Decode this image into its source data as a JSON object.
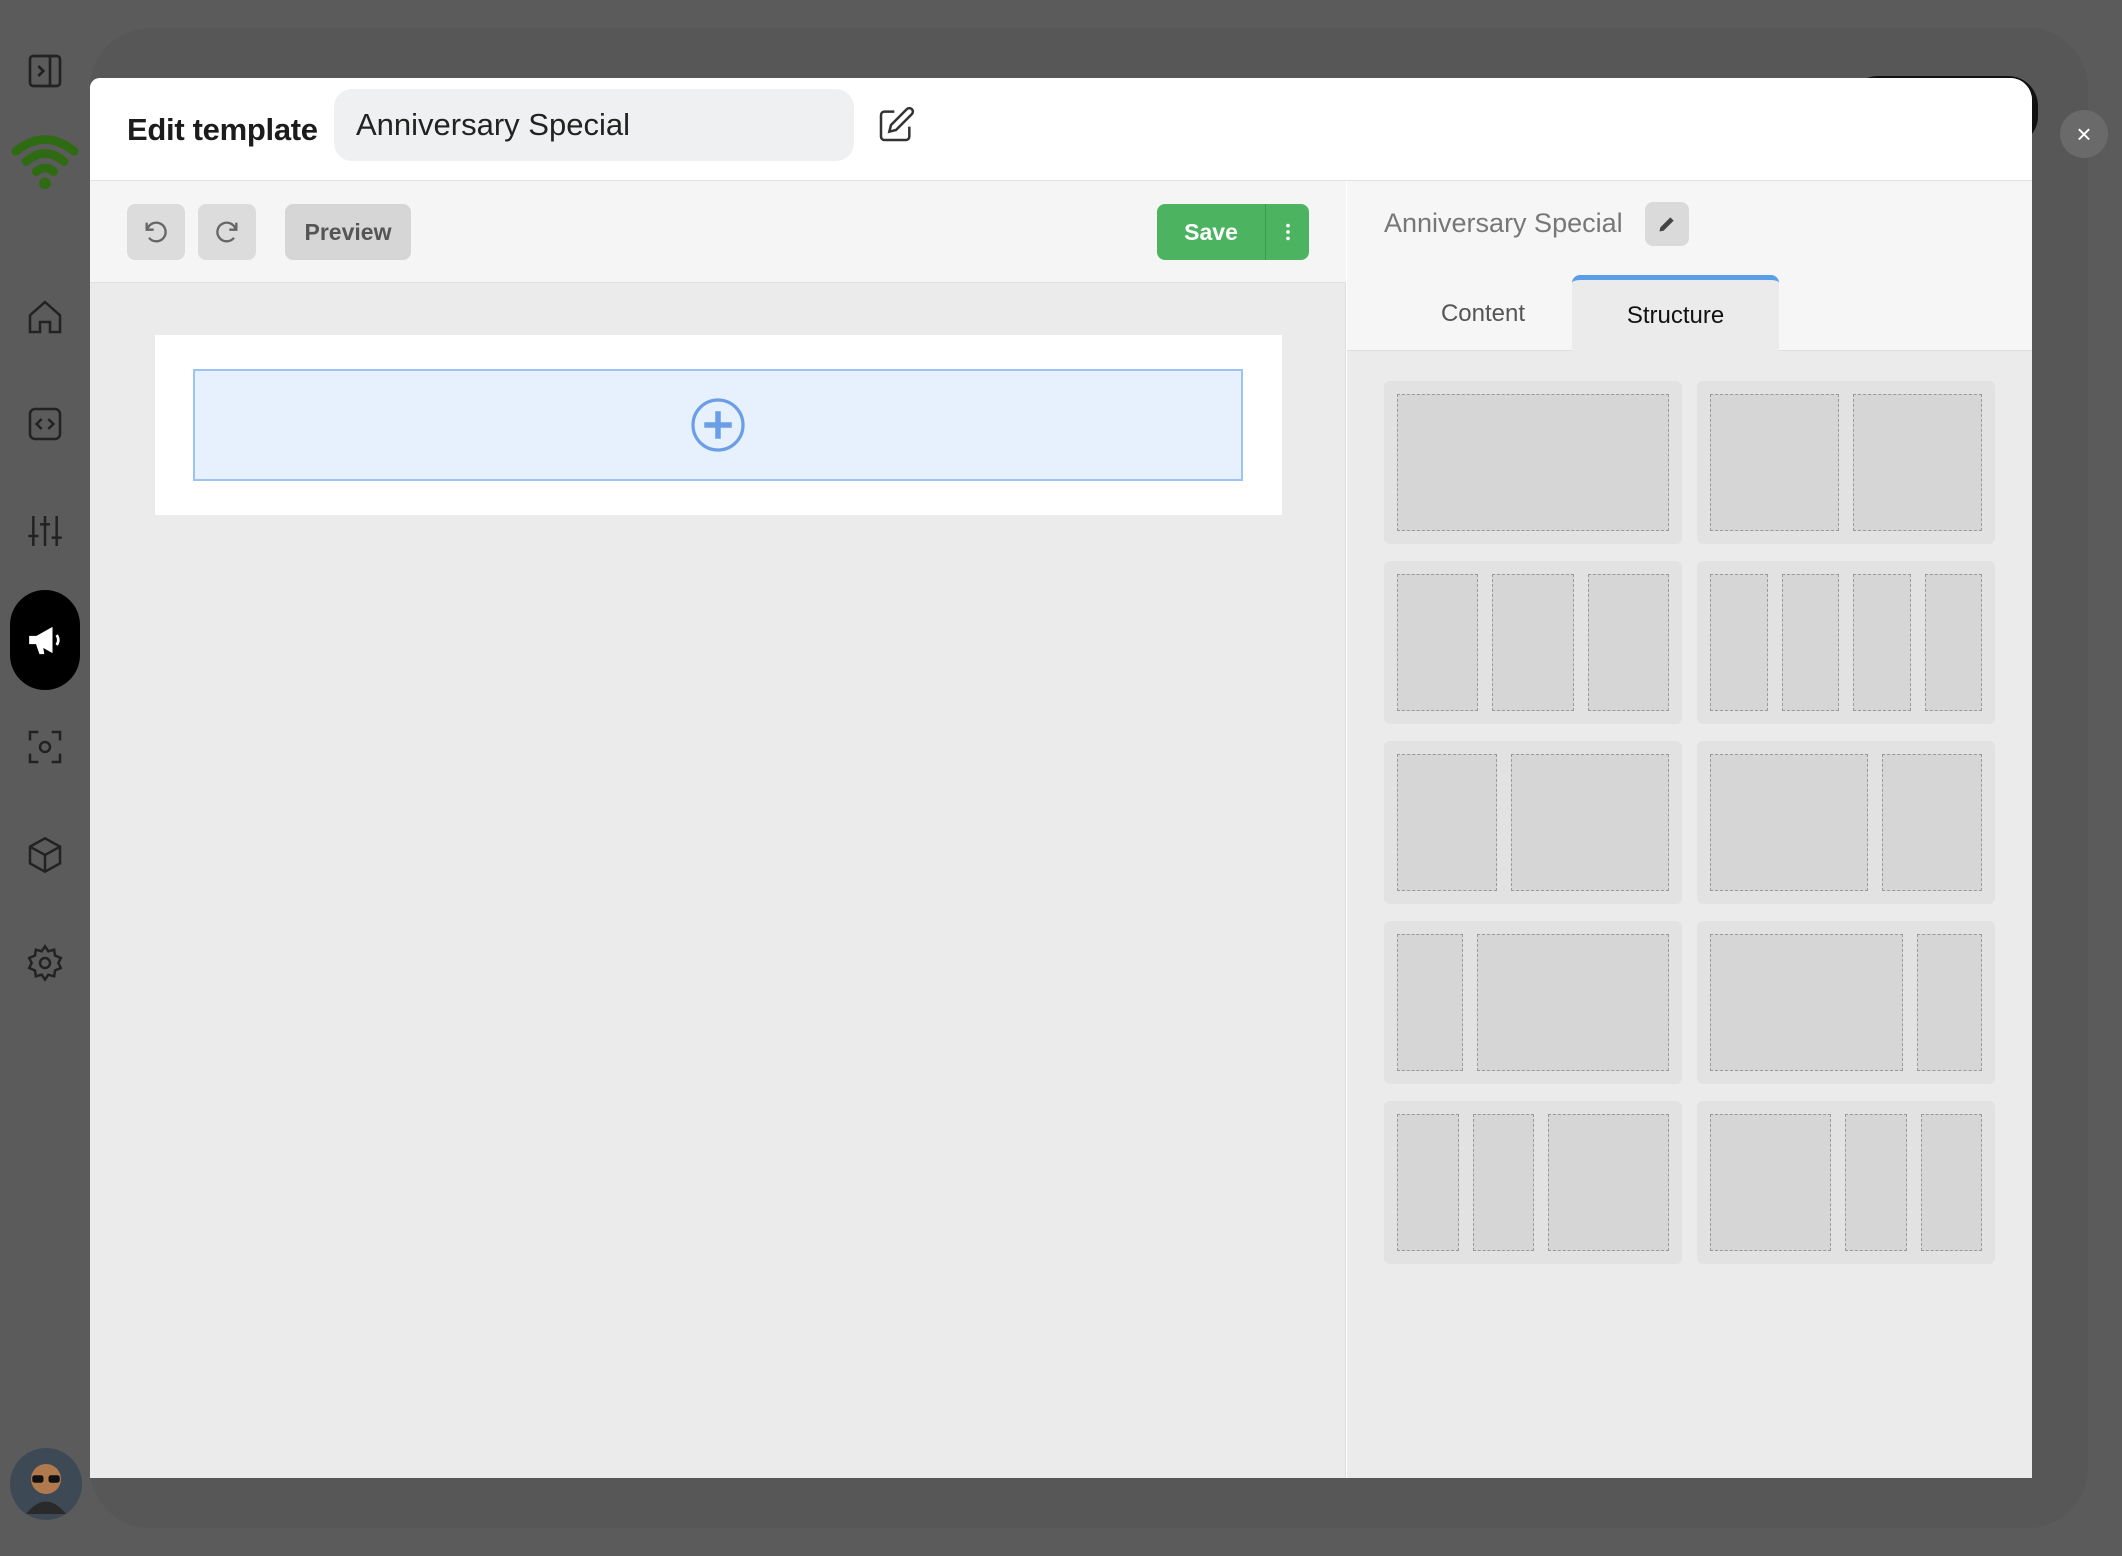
{
  "modal": {
    "title": "Edit template",
    "template_name": "Anniversary Special",
    "close_symbol": "×"
  },
  "toolbar": {
    "preview_label": "Preview",
    "save_label": "Save"
  },
  "side_panel": {
    "title": "Anniversary Special",
    "tabs": [
      {
        "label": "Content",
        "active": false
      },
      {
        "label": "Structure",
        "active": true
      }
    ]
  },
  "structure_layouts": [
    {
      "name": "layout-1-column",
      "columns": [
        1
      ]
    },
    {
      "name": "layout-2-columns",
      "columns": [
        1,
        1
      ]
    },
    {
      "name": "layout-3-columns",
      "columns": [
        1,
        1,
        1
      ]
    },
    {
      "name": "layout-4-columns",
      "columns": [
        1,
        1,
        1,
        1
      ]
    },
    {
      "name": "layout-1-2",
      "columns": [
        1,
        1.6
      ]
    },
    {
      "name": "layout-2-1",
      "columns": [
        1.6,
        1
      ]
    },
    {
      "name": "layout-1-3",
      "columns": [
        1,
        3
      ]
    },
    {
      "name": "layout-3-1",
      "columns": [
        3,
        1
      ]
    },
    {
      "name": "layout-1-1-2",
      "columns": [
        1,
        1,
        2
      ]
    },
    {
      "name": "layout-2-1-1",
      "columns": [
        2,
        1,
        1
      ]
    }
  ],
  "icons": {
    "sidebar": [
      "sidebar-toggle-icon",
      "wifi-logo-icon",
      "home-icon",
      "code-icon",
      "sliders-icon",
      "megaphone-icon",
      "scan-icon",
      "cube-icon",
      "gear-icon"
    ],
    "undo": "undo-icon",
    "redo": "redo-icon",
    "more": "more-vertical-icon",
    "add": "plus-circle-icon",
    "edit": "edit-icon",
    "pencil": "pencil-icon"
  },
  "colors": {
    "save_green": "#4cb460",
    "tab_accent": "#5b9ee8",
    "dropzone_fill": "#e6f1fd",
    "dropzone_border": "#9cc3f3",
    "brand_green": "#2f6b12"
  }
}
